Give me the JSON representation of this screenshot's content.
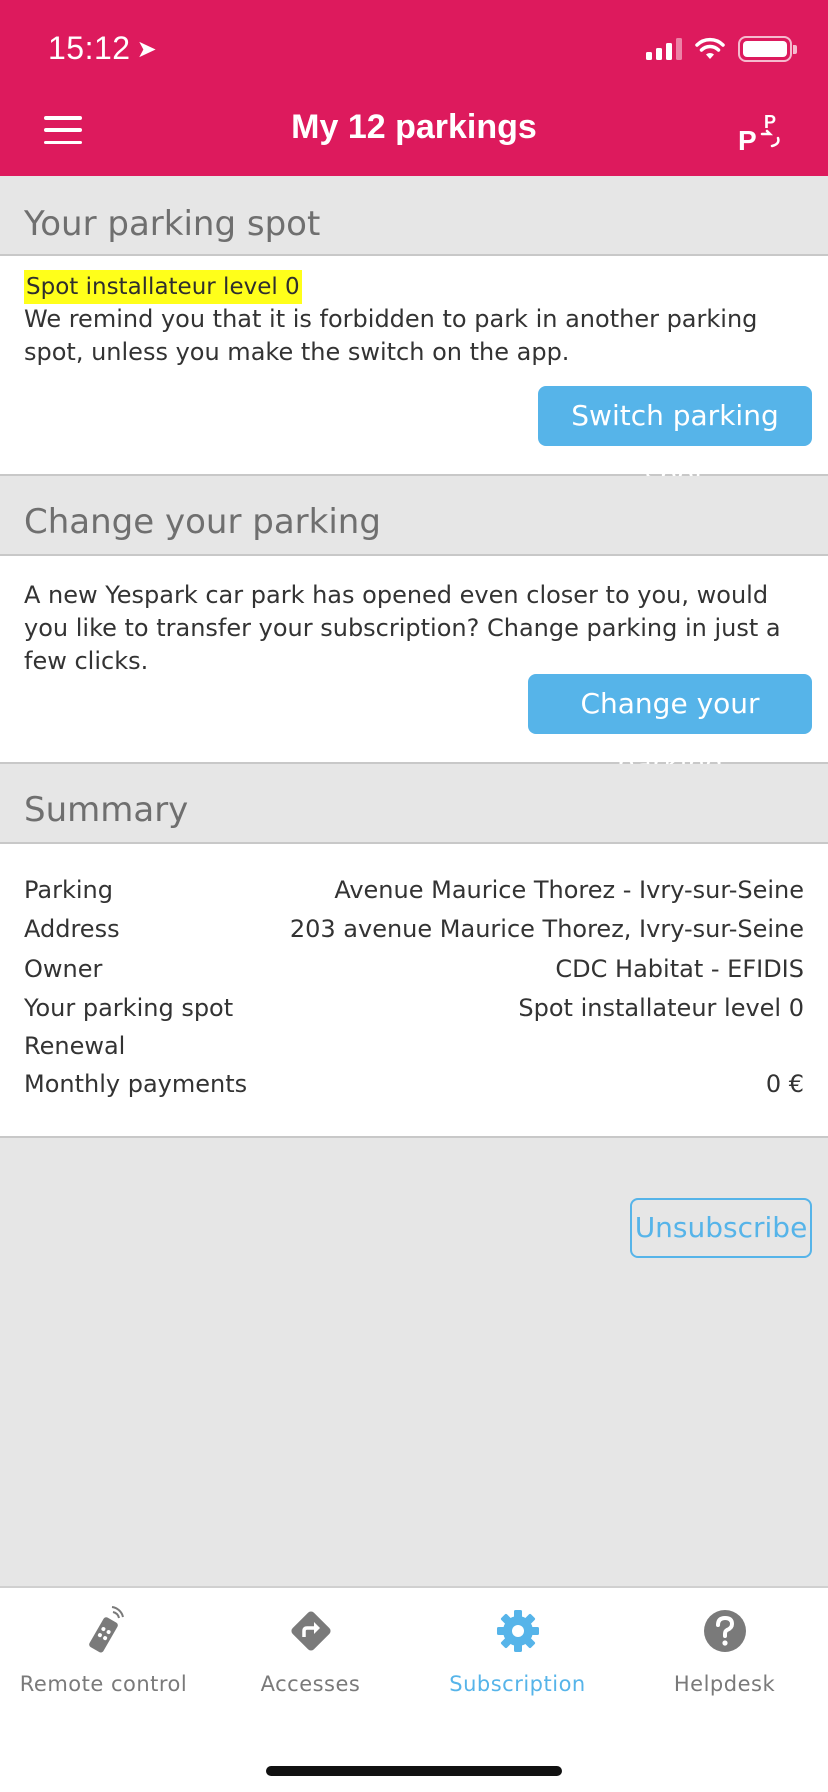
{
  "status_bar": {
    "time": "15:12"
  },
  "header": {
    "title": "My 12 parkings"
  },
  "spot_section": {
    "heading": "Your parking spot",
    "highlight": "Spot installateur level 0",
    "text": "We remind you that it is forbidden to park in another parking spot, unless you make the switch on the app.",
    "button": "Switch parking spot"
  },
  "change_section": {
    "heading": "Change your parking",
    "text": "A new Yespark car park has opened even closer to you, would you like to transfer your subscription? Change parking in just a few clicks.",
    "button": "Change your parking"
  },
  "summary": {
    "heading": "Summary",
    "rows": [
      {
        "label": "Parking",
        "value": "Avenue Maurice Thorez - Ivry-sur-Seine"
      },
      {
        "label": "Address",
        "value": "203 avenue Maurice Thorez, Ivry-sur-Seine"
      },
      {
        "label": "Owner",
        "value": "CDC Habitat - EFIDIS"
      },
      {
        "label": "Your parking spot",
        "value": "Spot installateur level 0"
      },
      {
        "label": "Renewal",
        "value": ""
      },
      {
        "label": "Monthly payments",
        "value": "0 €"
      }
    ]
  },
  "unsubscribe_label": "Unsubscribe",
  "tabs": [
    {
      "label": "Remote control",
      "icon": "remote-control-icon"
    },
    {
      "label": "Accesses",
      "icon": "directions-icon"
    },
    {
      "label": "Subscription",
      "icon": "gear-icon",
      "active": true
    },
    {
      "label": "Helpdesk",
      "icon": "help-icon"
    }
  ],
  "colors": {
    "brand": "#dd1a5d",
    "accent": "#56b4e9",
    "highlight": "#ffff1a"
  }
}
